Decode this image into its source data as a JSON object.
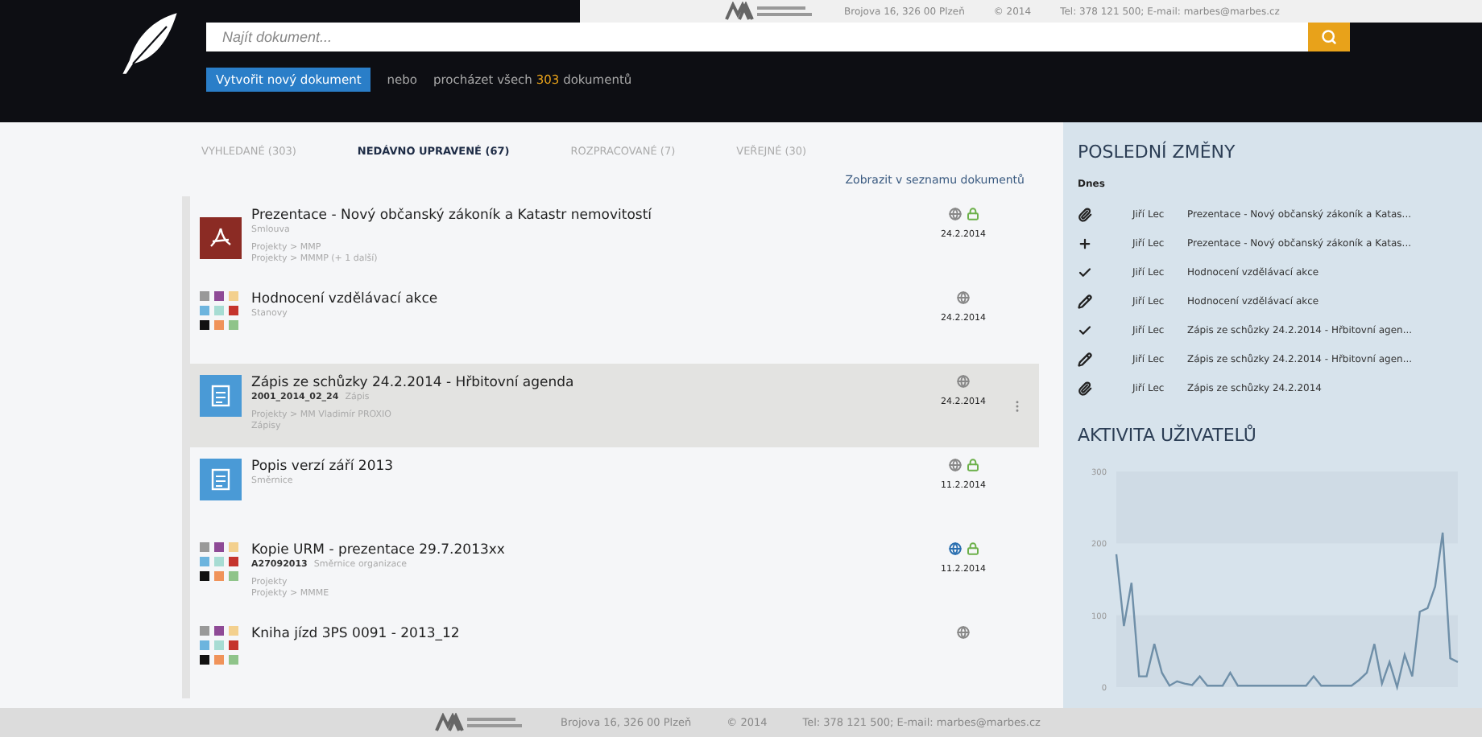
{
  "topbar": {
    "address": "Brojova 16, 326 00 Plzeň",
    "copyright": "© 2014",
    "contact": "Tel: 378 121 500; E-mail: marbes@marbes.cz"
  },
  "search": {
    "placeholder": "Najít dokument..."
  },
  "actions": {
    "create_button": "Vytvořit nový dokument",
    "or": "nebo",
    "browse": "procházet všech",
    "count": "303",
    "browse_suffix": "dokumentů"
  },
  "tabs": [
    {
      "label": "VYHLEDANÉ (303)",
      "selected": false
    },
    {
      "label": "NEDÁVNO UPRAVENÉ (67)",
      "selected": true
    },
    {
      "label": "ROZPRACOVANÉ (7)",
      "selected": false
    },
    {
      "label": "VEŘEJNÉ (30)",
      "selected": false
    }
  ],
  "list_link": "Zobrazit v seznamu dokumentů",
  "documents": [
    {
      "kind": "pdf",
      "title": "Prezentace - Nový občanský zákoník a Katastr nemovitostí",
      "category": "Smlouva",
      "paths": [
        "Projekty > MMP",
        "Projekty > MMMP (+ 1 další)"
      ],
      "public": false,
      "locked": true,
      "date": "24.2.2014",
      "selected": false
    },
    {
      "kind": "tiles",
      "title": "Hodnocení vzdělávací akce",
      "category": "Stanovy",
      "public": false,
      "locked": false,
      "date": "24.2.2014",
      "selected": false
    },
    {
      "kind": "doc",
      "title": "Zápis ze schůzky 24.2.2014 - Hřbitovní agenda",
      "code": "2001_2014_02_24",
      "category": "Zápis",
      "paths": [
        "Projekty > MM Vladimír PROXIO",
        "Zápisy"
      ],
      "public": false,
      "locked": false,
      "date": "24.2.2014",
      "selected": true
    },
    {
      "kind": "doc",
      "title": "Popis verzí září 2013",
      "category": "Směrnice",
      "public": false,
      "locked": true,
      "date": "11.2.2014",
      "selected": false
    },
    {
      "kind": "tiles",
      "title": "Kopie URM - prezentace 29.7.2013xx",
      "code": "A27092013",
      "category": "Směrnice organizace",
      "paths": [
        "Projekty",
        "Projekty > MMME"
      ],
      "public": true,
      "locked": true,
      "date": "11.2.2014",
      "selected": false
    },
    {
      "kind": "tiles",
      "title": "Kniha jízd 3PS 0091 - 2013_12",
      "public": false,
      "locked": false,
      "selected": false
    }
  ],
  "changes": {
    "title": "POSLEDNÍ ZMĚNY",
    "day": "Dnes",
    "items": [
      {
        "kind": "attach",
        "user": "Jiří Lec",
        "text": "Prezentace - Nový občanský zákoník a Katas..."
      },
      {
        "kind": "add",
        "user": "Jiří Lec",
        "text": "Prezentace - Nový občanský zákoník a Katas..."
      },
      {
        "kind": "check",
        "user": "Jiří Lec",
        "text": "Hodnocení vzdělávací akce"
      },
      {
        "kind": "edit",
        "user": "Jiří Lec",
        "text": "Hodnocení vzdělávací akce"
      },
      {
        "kind": "check",
        "user": "Jiří Lec",
        "text": "Zápis ze schůzky 24.2.2014 - Hřbitovní agen..."
      },
      {
        "kind": "edit",
        "user": "Jiří Lec",
        "text": "Zápis ze schůzky 24.2.2014 - Hřbitovní agen..."
      },
      {
        "kind": "attach",
        "user": "Jiří Lec",
        "text": "Zápis ze schůzky 24.2.2014"
      }
    ]
  },
  "activity": {
    "title": "AKTIVITA UŽIVATELŮ",
    "chart_data": {
      "type": "line",
      "ylim": [
        0,
        300
      ],
      "yticks": [
        0,
        100,
        200,
        300
      ],
      "series": [
        {
          "color": "#6f8fa8",
          "values": [
            185,
            85,
            145,
            15,
            15,
            60,
            20,
            2,
            8,
            5,
            3,
            15,
            2,
            2,
            2,
            20,
            2,
            2,
            2,
            2,
            2,
            2,
            2,
            2,
            2,
            2,
            15,
            2,
            2,
            2,
            2,
            2,
            10,
            20,
            60,
            5,
            35,
            0,
            45,
            15,
            105,
            110,
            140,
            215,
            40,
            35
          ]
        }
      ]
    }
  },
  "footer": {
    "address": "Brojova 16, 326 00 Plzeň",
    "copyright": "© 2014",
    "contact": "Tel: 378 121 500; E-mail: marbes@marbes.cz"
  }
}
